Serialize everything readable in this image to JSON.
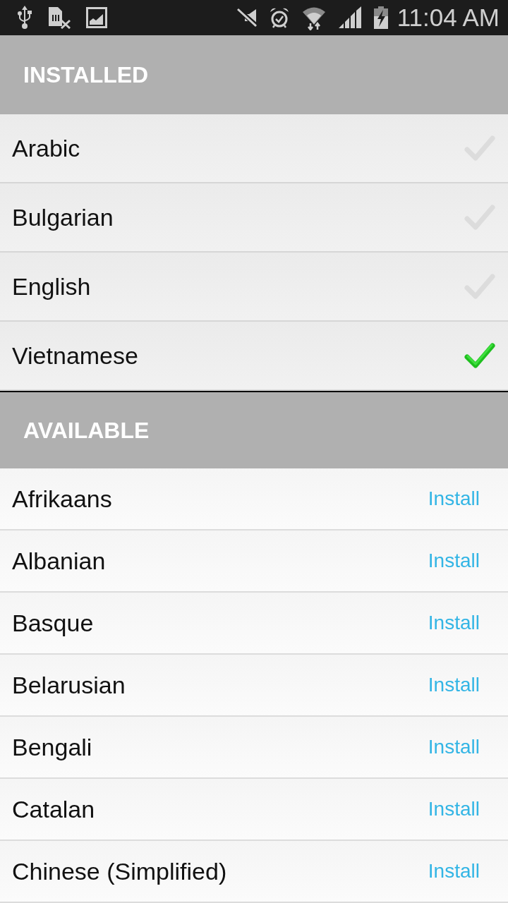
{
  "status_bar": {
    "time": "11:04 AM"
  },
  "installed": {
    "title": "INSTALLED",
    "items": [
      {
        "name": "Arabic",
        "selected": false
      },
      {
        "name": "Bulgarian",
        "selected": false
      },
      {
        "name": "English",
        "selected": false
      },
      {
        "name": "Vietnamese",
        "selected": true
      }
    ]
  },
  "available": {
    "title": "AVAILABLE",
    "items": [
      {
        "name": "Afrikaans",
        "action": "Install"
      },
      {
        "name": "Albanian",
        "action": "Install"
      },
      {
        "name": "Basque",
        "action": "Install"
      },
      {
        "name": "Belarusian",
        "action": "Install"
      },
      {
        "name": "Bengali",
        "action": "Install"
      },
      {
        "name": "Catalan",
        "action": "Install"
      },
      {
        "name": "Chinese (Simplified)",
        "action": "Install"
      }
    ]
  }
}
